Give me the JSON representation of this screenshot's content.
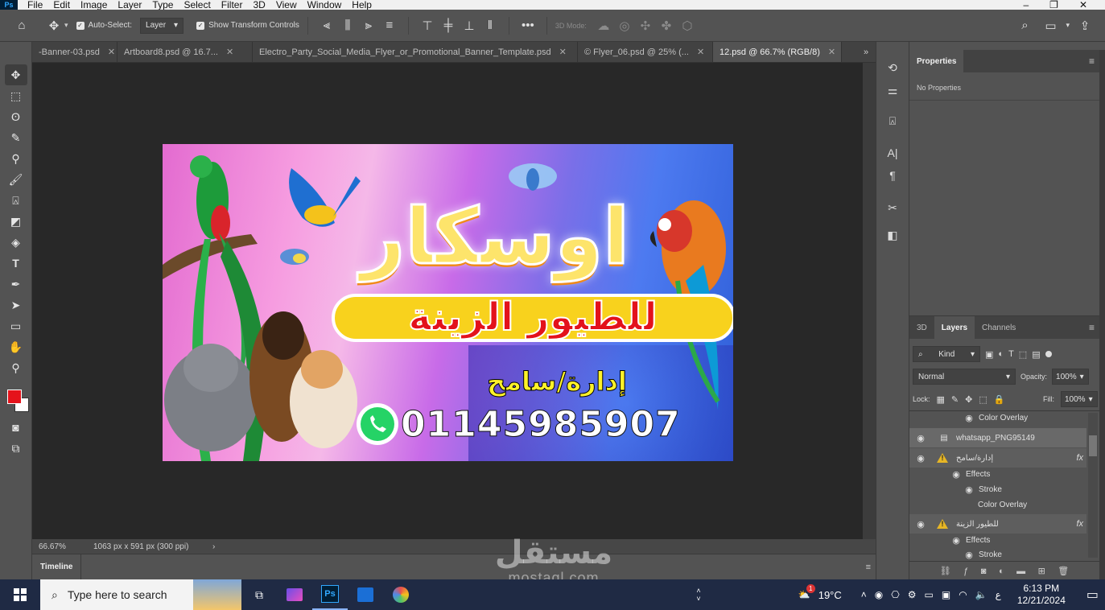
{
  "menu": {
    "app_badge": "Ps",
    "items": [
      "File",
      "Edit",
      "Image",
      "Layer",
      "Type",
      "Select",
      "Filter",
      "3D",
      "View",
      "Window",
      "Help"
    ]
  },
  "options": {
    "auto_select_label": "Auto-Select:",
    "layer_select": "Layer",
    "transform_label": "Show Transform Controls",
    "mode_3d_label": "3D Mode:"
  },
  "tabs": [
    {
      "label": "-Banner-03.psd"
    },
    {
      "label": "Artboard8.psd @ 16.7..."
    },
    {
      "label": "Electro_Party_Social_Media_Flyer_or_Promotional_Banner_Template.psd"
    },
    {
      "label": "© Flyer_06.psd @ 25% (..."
    },
    {
      "label": "12.psd @ 66.7% (RGB/8)"
    }
  ],
  "artwork": {
    "title": "اوسكار",
    "subtitle": "للطيور الزينة",
    "manager": "إدارة/سامح",
    "phone": "01145985907"
  },
  "status": {
    "zoom": "66.67%",
    "doc_info": "1063 px x 591 px (300 ppi)"
  },
  "timeline_label": "Timeline",
  "properties": {
    "tab": "Properties",
    "empty": "No Properties"
  },
  "layers_panel": {
    "tabs": [
      "3D",
      "Layers",
      "Channels"
    ],
    "kind_filter": "Kind",
    "blend_mode": "Normal",
    "opacity_label": "Opacity:",
    "opacity_value": "100%",
    "lock_label": "Lock:",
    "fill_label": "Fill:",
    "fill_value": "100%",
    "rows": {
      "r0": "Color Overlay",
      "r1": "whatsapp_PNG95149",
      "r2": "إدارة/سامح",
      "r3": "Effects",
      "r4": "Stroke",
      "r5": "Color Overlay",
      "r6": "للطيور الزينة",
      "r7": "Effects",
      "r8": "Stroke"
    },
    "fx": "fx"
  },
  "watermark": {
    "arabic": "مستقل",
    "latin": "mostaql.com"
  },
  "taskbar": {
    "search_placeholder": "Type here to search",
    "weather": "19°C",
    "lang": "ع",
    "time": "6:13 PM",
    "date": "12/21/2024",
    "notif_badge": "1"
  }
}
